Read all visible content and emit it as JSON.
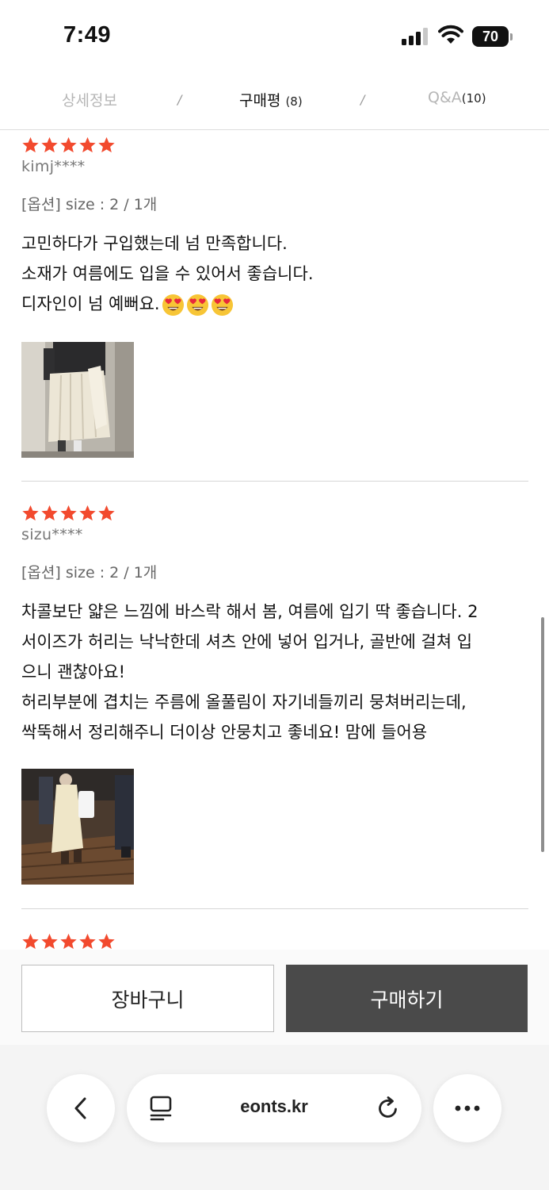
{
  "status": {
    "time": "7:49",
    "battery": "70"
  },
  "tabs": [
    {
      "label": "상세정보",
      "count": ""
    },
    {
      "label": "구매평",
      "count": "(8)"
    },
    {
      "label": "Q&A",
      "count": "(10)"
    }
  ],
  "tab_separator": "/",
  "reviews": [
    {
      "rating": 5,
      "author": "kimj****",
      "option": "[옵션] size : 2 / 1개",
      "text": "고민하다가 구입했는데 넘 만족합니다.\n소재가 여름에도 입을 수 있어서 좋습니다.\n디자인이 넘 예뻐요.",
      "emoji_count": 3,
      "emoji_icon": "heart-eyes-emoji-icon"
    },
    {
      "rating": 5,
      "author": "sizu****",
      "option": "[옵션] size : 2 / 1개",
      "text": "차콜보단 얇은 느낌에 바스락 해서 봄, 여름에 입기 딱 좋습니다. 2\n서이즈가 허리는 낙낙한데 셔츠 안에 넣어 입거나, 골반에 걸쳐 입\n으니 괜찮아요!\n허리부분에 겹치는 주름에 올풀림이 자기네들끼리 뭉쳐버리는데,\n싹뚝해서 정리해주니 더이상 안뭉치고 좋네요! 맘에 들어용"
    },
    {
      "rating": 5
    }
  ],
  "actions": {
    "cart": "장바구니",
    "buy": "구매하기"
  },
  "browser": {
    "url": "eonts.kr"
  },
  "colors": {
    "star": "#f24a2e",
    "buy_bg": "#4a4a4a",
    "tab_inactive": "#b6b6b6"
  }
}
